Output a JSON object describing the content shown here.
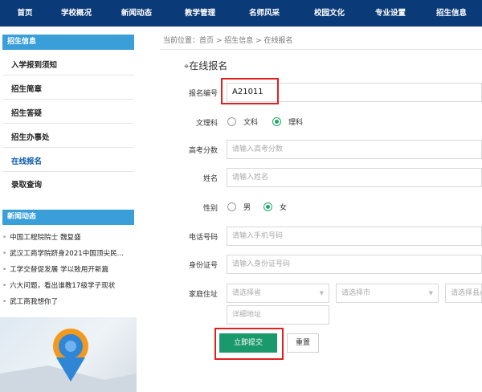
{
  "nav": [
    "首页",
    "学校概况",
    "新闻动态",
    "教学管理",
    "名师风采",
    "校园文化",
    "专业设置",
    "招生信息"
  ],
  "sidebar": {
    "section1_title": "招生信息",
    "items": [
      "入学报到须知",
      "招生简章",
      "招生答疑",
      "招生办事处",
      "在线报名",
      "录取查询"
    ],
    "section2_title": "新闻动态",
    "news": [
      "中国工程院院士 魏复盛",
      "武汉工商学院跻身2021中国顶尖民...",
      "工学交替促发展 学以致用开新篇",
      "六大问题，看出谁教17级学子现状",
      "武工商我想你了"
    ]
  },
  "breadcrumb": "当前位置：首页 > 招生信息 > 在线报名",
  "form": {
    "title": "在线报名",
    "title_icon": "tag-icon",
    "reg_no": {
      "label": "报名编号",
      "value": "A21011"
    },
    "track": {
      "label": "文理科",
      "options": [
        "文科",
        "理科"
      ],
      "selected": "理科"
    },
    "score": {
      "label": "高考分数",
      "placeholder": "请输入高考分数"
    },
    "name": {
      "label": "姓名",
      "placeholder": "请输入姓名"
    },
    "gender": {
      "label": "性别",
      "options": [
        "男",
        "女"
      ],
      "selected": "女"
    },
    "phone": {
      "label": "电话号码",
      "placeholder": "请输入手机号码"
    },
    "id_card": {
      "label": "身份证号",
      "placeholder": "请输入身份证号码"
    },
    "address": {
      "label": "家庭住址",
      "province_placeholder": "请选择省",
      "city_placeholder": "请选择市",
      "county_placeholder": "请选择县/区",
      "detail_placeholder": "详细地址"
    },
    "submit_label": "立即提交",
    "reset_label": "重置"
  },
  "colors": {
    "nav_bg": "#0b3a78",
    "sidebar_header": "#3a9fd9",
    "accent_green": "#1a9a6c",
    "highlight_red": "#e0201e"
  }
}
